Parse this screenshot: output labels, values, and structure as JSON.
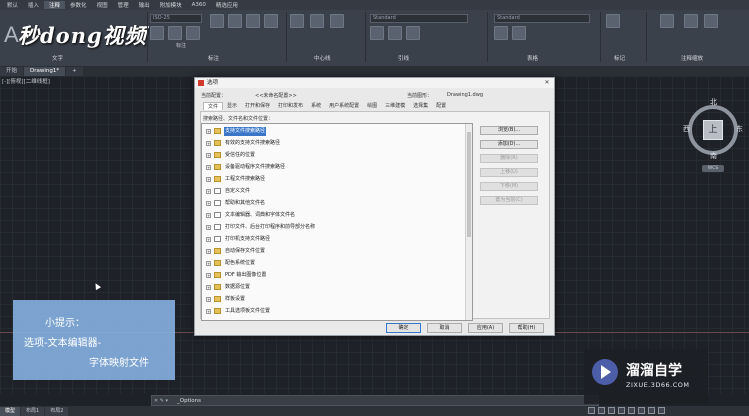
{
  "menubar": {
    "items": [
      "默认",
      "插入",
      "注释",
      "参数化",
      "视图",
      "管理",
      "输出",
      "附加模块",
      "A360",
      "精选应用",
      "",
      ""
    ],
    "active_index": 2
  },
  "ribbon": {
    "logo_text": "秒dong视频",
    "panel_labels": {
      "text": "文字",
      "dimensions": "标注",
      "centerlines": "中心线",
      "leaders": "引线",
      "tables": "表格",
      "markup": "标记",
      "annotation_scaling": "注释缩放"
    },
    "style_combo_1": "Standard",
    "style_combo_2": "Standard",
    "dim_combo": "ISO-25",
    "small_labels": [
      "标注"
    ]
  },
  "file_tabs": [
    {
      "label": "开始",
      "active": false
    },
    {
      "label": "Drawing1*",
      "active": true
    },
    {
      "label": "+",
      "active": false
    }
  ],
  "viewport_label": "[-][俯视][二维线框]",
  "viewcube": {
    "face": "上",
    "north": "北",
    "south": "南",
    "east": "东",
    "west": "西",
    "wcs": "WCS"
  },
  "dialog": {
    "title": "选项",
    "current_profile_label": "当前配置：",
    "current_profile_value": "<<未命名配置>>",
    "current_drawing_label": "当前图形：",
    "current_drawing_value": "Drawing1.dwg",
    "tabs": [
      "文件",
      "显示",
      "打开和保存",
      "打印和发布",
      "系统",
      "用户系统配置",
      "绘图",
      "三维建模",
      "选择集",
      "配置"
    ],
    "active_tab_index": 0,
    "tree_header": "搜索路径、文件名和文件位置：",
    "tree_items": [
      {
        "label": "支持文件搜索路径",
        "icon": "folder",
        "selected": true
      },
      {
        "label": "有效的支持文件搜索路径",
        "icon": "folder",
        "selected": false
      },
      {
        "label": "受信任的位置",
        "icon": "folder",
        "selected": false
      },
      {
        "label": "设备驱动程序文件搜索路径",
        "icon": "folder",
        "selected": false
      },
      {
        "label": "工程文件搜索路径",
        "icon": "folder",
        "selected": false
      },
      {
        "label": "自定义文件",
        "icon": "doc",
        "selected": false
      },
      {
        "label": "帮助和其他文件名",
        "icon": "doc",
        "selected": false
      },
      {
        "label": "文本编辑器、词典和字体文件名",
        "icon": "doc",
        "selected": false
      },
      {
        "label": "打印文件、后台打印程序和前导部分名称",
        "icon": "doc",
        "selected": false
      },
      {
        "label": "打印机支持文件路径",
        "icon": "doc",
        "selected": false
      },
      {
        "label": "自动保存文件位置",
        "icon": "folder",
        "selected": false
      },
      {
        "label": "配色系统位置",
        "icon": "folder",
        "selected": false
      },
      {
        "label": "PDF 输出图像位置",
        "icon": "folder",
        "selected": false
      },
      {
        "label": "数据源位置",
        "icon": "folder",
        "selected": false
      },
      {
        "label": "样板设置",
        "icon": "folder",
        "selected": false
      },
      {
        "label": "工具选项板文件位置",
        "icon": "folder",
        "selected": false
      }
    ],
    "side_buttons": [
      {
        "label": "浏览(B)...",
        "enabled": true
      },
      {
        "label": "添加(D)...",
        "enabled": true
      },
      {
        "label": "删除(R)",
        "enabled": false
      },
      {
        "label": "上移(U)",
        "enabled": false
      },
      {
        "label": "下移(M)",
        "enabled": false
      },
      {
        "label": "置为当前(C)",
        "enabled": false
      }
    ],
    "bottom_buttons": [
      {
        "label": "确定",
        "primary": true
      },
      {
        "label": "取消",
        "primary": false
      },
      {
        "label": "应用(A)",
        "primary": false
      },
      {
        "label": "帮助(H)",
        "primary": false
      }
    ]
  },
  "command_line": {
    "icons_text": "✕ ✎ ▾",
    "text": "_Options"
  },
  "layout_tabs": [
    {
      "label": "模型",
      "active": true
    },
    {
      "label": "布局1",
      "active": false
    },
    {
      "label": "布局2",
      "active": false
    }
  ],
  "tip": {
    "heading": "小提示：",
    "line1": "选项-文本编辑器-",
    "line2": "字体映射文件"
  },
  "watermark": {
    "title": "溜溜自学",
    "url": "ZIXUE.3D66.COM"
  },
  "colors": {
    "drawing_bg": "#1e2127",
    "ribbon_bg": "#3b414b",
    "tip_bg": "#84afde",
    "selection": "#3a76c8"
  }
}
